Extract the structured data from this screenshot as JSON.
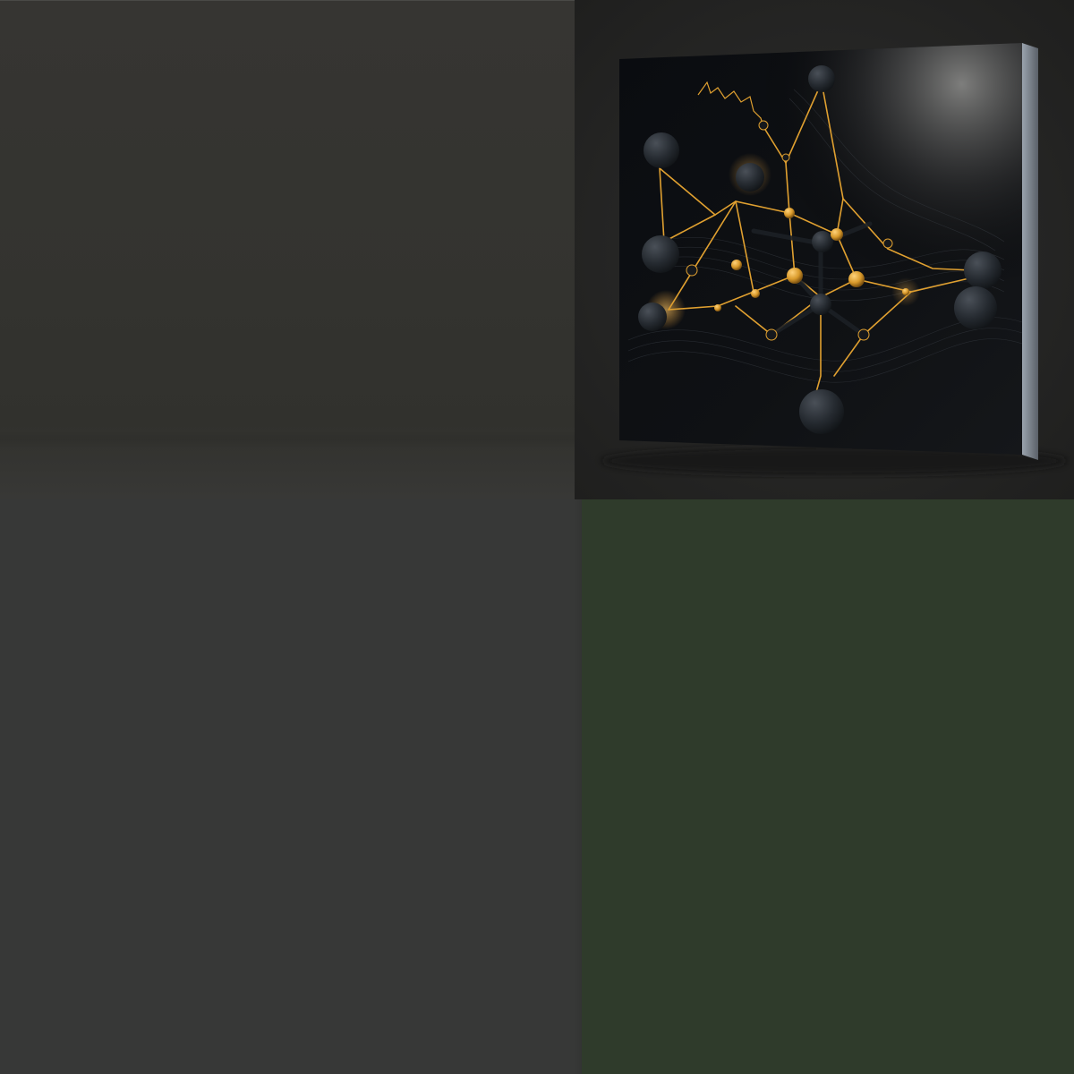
{
  "panels": [
    {
      "name": "top-left-panel",
      "color": "#343431"
    },
    {
      "name": "top-right-panel",
      "color": "#262625"
    },
    {
      "name": "bottom-left-panel",
      "color": "#373837"
    },
    {
      "name": "bottom-right-panel",
      "color": "#2f3b2b"
    }
  ],
  "artwork": {
    "subject": "canvas-print-molecular-network",
    "accent_color": "#e0a030",
    "node_color": "#2a2e33",
    "background_color": "#0b0d10"
  }
}
